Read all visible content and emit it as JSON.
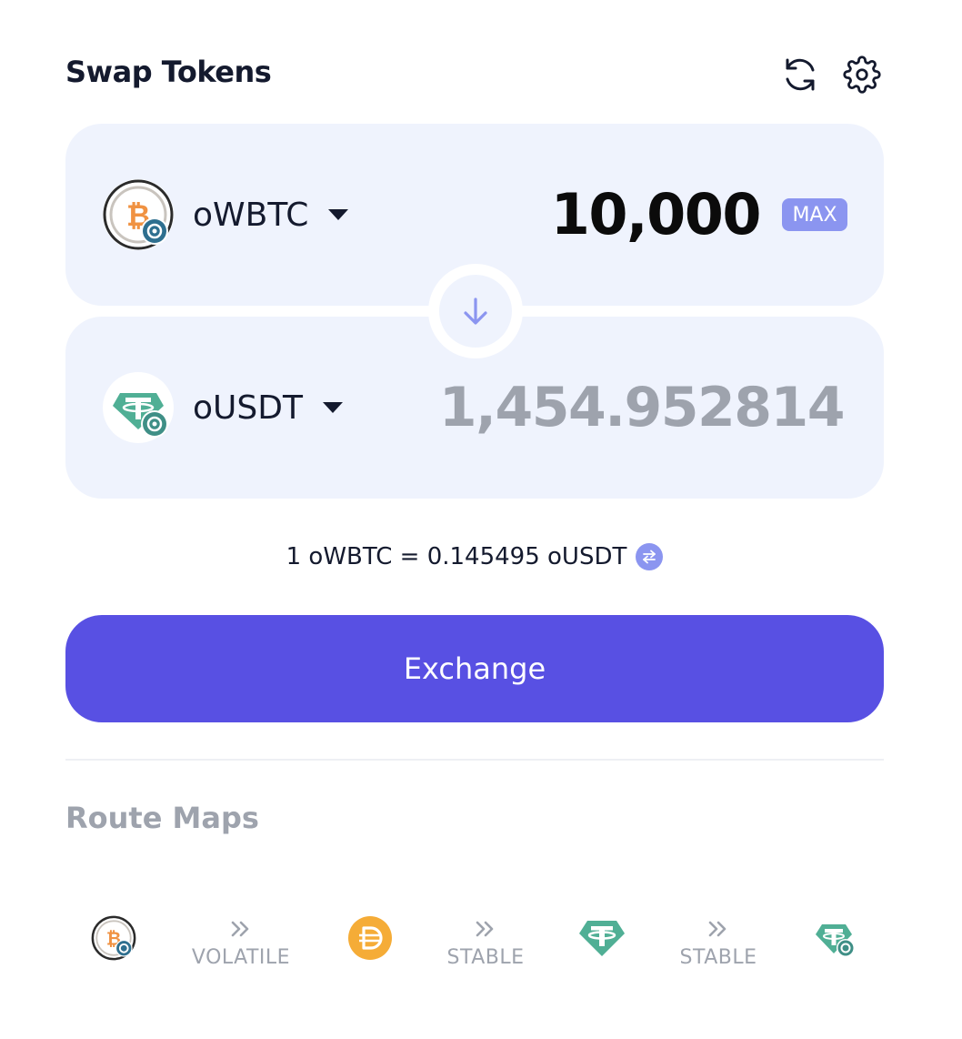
{
  "header": {
    "title": "Swap Tokens",
    "refresh_icon": "refresh-icon",
    "settings_icon": "gear-icon"
  },
  "from": {
    "token": "oWBTC",
    "amount": "10,000",
    "max_label": "MAX",
    "icon": "wbtc-token-icon"
  },
  "to": {
    "token": "oUSDT",
    "amount": "1,454.952814",
    "icon": "usdt-token-icon"
  },
  "swap_direction_icon": "arrow-down-icon",
  "rate": {
    "text": "1 oWBTC = 0.145495 oUSDT",
    "icon": "swap-arrows-icon"
  },
  "exchange": {
    "label": "Exchange"
  },
  "route": {
    "title": "Route Maps",
    "tokens": [
      "wbtc-token-icon",
      "dai-token-icon",
      "usdt-token-icon",
      "ousdt-token-icon"
    ],
    "steps": [
      {
        "pool": "VOLATILE",
        "icon": "double-chevron-right-icon"
      },
      {
        "pool": "STABLE",
        "icon": "double-chevron-right-icon"
      },
      {
        "pool": "STABLE",
        "icon": "double-chevron-right-icon"
      }
    ]
  },
  "colors": {
    "accent": "#5850e3",
    "max_badge": "#8b95f0",
    "panel_bg": "#eff3fd",
    "btc_orange": "#f09242",
    "tether_green": "#50af95",
    "dai_yellow": "#f5ac37",
    "muted_text": "#9ea3ad"
  }
}
